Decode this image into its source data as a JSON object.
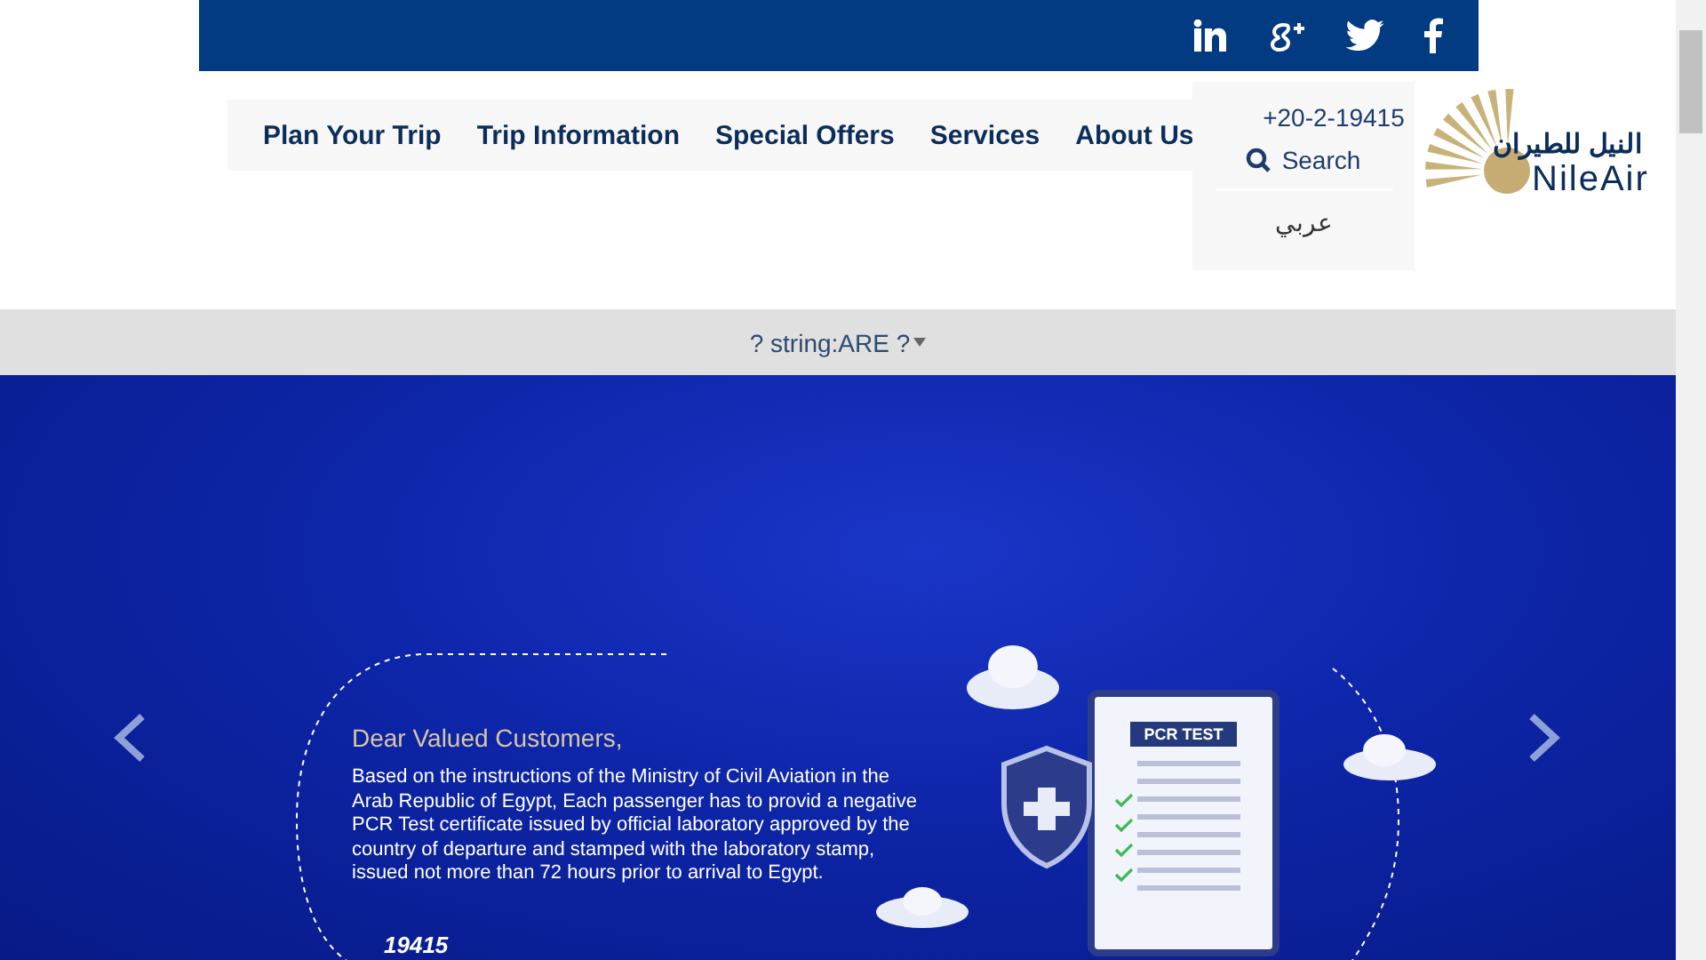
{
  "social_links": [
    {
      "kind": "linkedin"
    },
    {
      "kind": "google-plus"
    },
    {
      "kind": "twitter"
    },
    {
      "kind": "facebook"
    }
  ],
  "nav": {
    "items": [
      {
        "label": "Plan Your Trip"
      },
      {
        "label": "Trip Information"
      },
      {
        "label": "Special Offers"
      },
      {
        "label": "Services"
      },
      {
        "label": "About Us"
      }
    ]
  },
  "header_menu": {
    "phone": "+20-2-19415",
    "search": "Search",
    "language": "عربي"
  },
  "logo": {
    "arabic": "النيل للطيران",
    "latin": "NileAir"
  },
  "country_select": {
    "value": "? string:ARE ?"
  },
  "banner": {
    "heading": "Dear Valued Customers,",
    "body": "Based on the instructions of the Ministry of Civil Aviation in the Arab Republic of Egypt, Each passenger has to provid a negative PCR Test certificate issued by official laboratory approved by the country of departure and stamped with the laboratory stamp, issued not more than 72 hours prior to arrival to Egypt.",
    "hotline": "19415",
    "clipboard_title": "PCR TEST"
  }
}
